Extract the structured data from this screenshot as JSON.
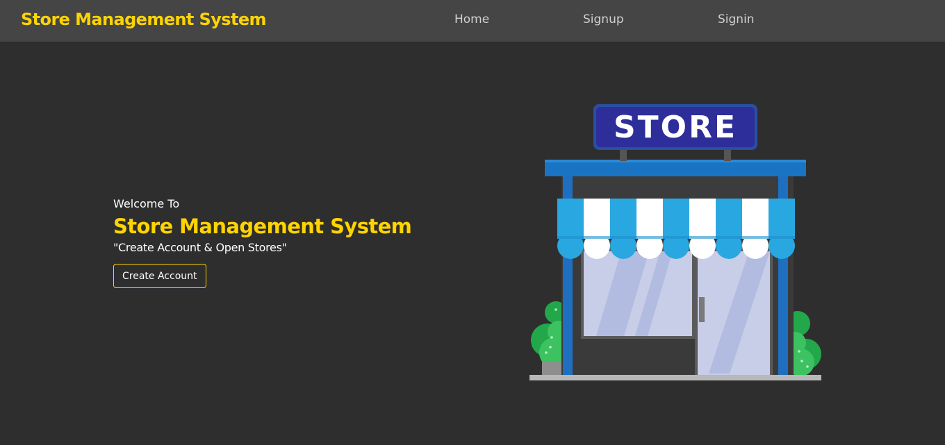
{
  "navbar": {
    "brand": "Store Management System",
    "links": [
      {
        "label": "Home"
      },
      {
        "label": "Signup"
      },
      {
        "label": "Signin"
      }
    ]
  },
  "hero": {
    "welcome": "Welcome To",
    "title": "Store Management System",
    "tagline": "\"Create Account & Open Stores\"",
    "cta_label": "Create Account"
  },
  "illustration": {
    "sign_text": "STORE"
  },
  "colors": {
    "background": "#2e2e2e",
    "navbar": "#454545",
    "accent": "#ffd400",
    "nav_text": "#d0d0d0"
  }
}
